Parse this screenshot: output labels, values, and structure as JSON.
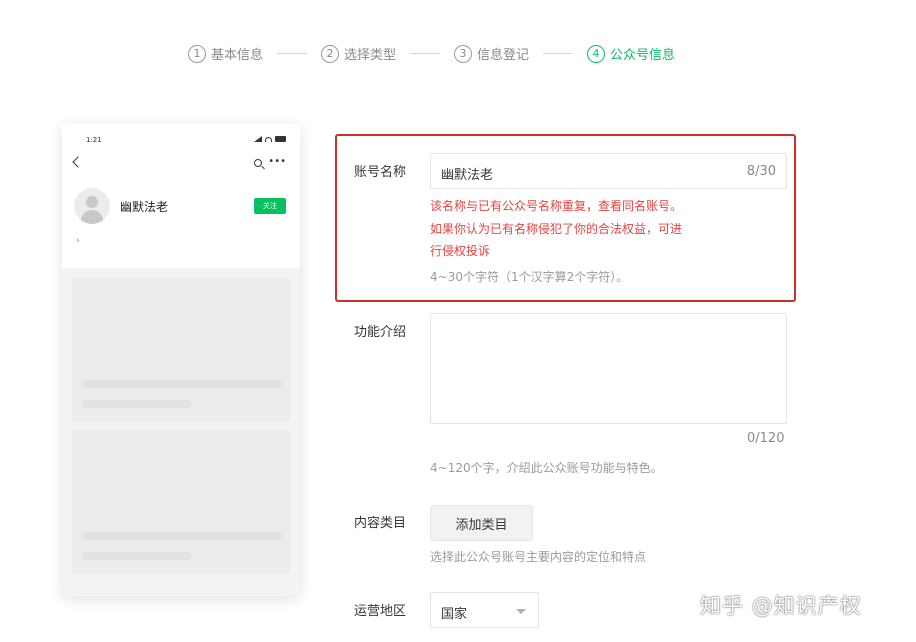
{
  "stepper": {
    "steps": [
      {
        "num": "1",
        "label": "基本信息"
      },
      {
        "num": "2",
        "label": "选择类型"
      },
      {
        "num": "3",
        "label": "信息登记"
      },
      {
        "num": "4",
        "label": "公众号信息"
      }
    ],
    "active_index": 3,
    "active_color": "#07c160"
  },
  "preview": {
    "time": "1:21",
    "account_name": "幽默法老",
    "follow_label": "关注",
    "chevron": "›"
  },
  "form": {
    "account_name": {
      "label": "账号名称",
      "value": "幽默法老",
      "counter": "8/30",
      "error_line1": "该名称与已有公众号名称重复，查看同名账号。",
      "error_line2": "如果你认为已有名称侵犯了你的合法权益，可进",
      "error_line3": "行侵权投诉",
      "hint": "4~30个字符（1个汉字算2个字符）。"
    },
    "intro": {
      "label": "功能介绍",
      "counter": "0/120",
      "hint": "4~120个字，介绍此公众账号功能与特色。"
    },
    "category": {
      "label": "内容类目",
      "button": "添加类目",
      "hint": "选择此公众号账号主要内容的定位和特点"
    },
    "region": {
      "label": "运营地区",
      "value": "国家"
    }
  },
  "watermark": "知乎 @知识产权",
  "colors": {
    "error": "#e64340",
    "highlight_border": "#c9302c",
    "brand_green": "#07c160"
  }
}
